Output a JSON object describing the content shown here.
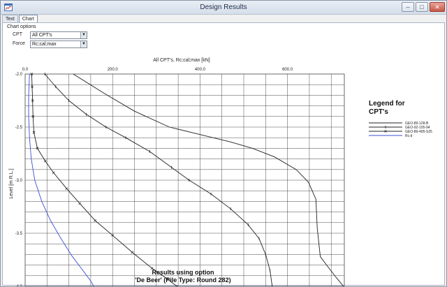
{
  "window": {
    "title": "Design Results",
    "minimize": "–",
    "maximize": "□",
    "close": "✕"
  },
  "tabs": [
    {
      "label": "Text"
    },
    {
      "label": "Chart"
    }
  ],
  "chart_options": {
    "title": "Chart options",
    "cpt_label": "CPT",
    "cpt_value": "All CPT's",
    "force_label": "Force",
    "force_value": "Rc;cal;max"
  },
  "chart_data": {
    "type": "line",
    "title": "All CPT's, Rc;cal;max [kN]",
    "ylabel": "Level [m R.L.]",
    "xlabel": "",
    "xlim": [
      0,
      730
    ],
    "ylim": [
      -4.0,
      -2.0
    ],
    "x_ticks": [
      "0.0",
      "200.0",
      "400.0",
      "600.0"
    ],
    "x_tick_values": [
      0,
      200,
      400,
      600
    ],
    "y_ticks": [
      "-2.0",
      "-2.5",
      "-3.0",
      "-3.5",
      "-4.0"
    ],
    "y_tick_values": [
      -2.0,
      -2.5,
      -3.0,
      -3.5,
      -4.0
    ],
    "grid": true,
    "legend_title": "Legend for CPT's",
    "legend_position": "right",
    "series": [
      {
        "name": "GEO-89-128-B",
        "color": "#222222",
        "marker": "none",
        "x": [
          110,
          180,
          250,
          330,
          410,
          470,
          520,
          570,
          620,
          648,
          665,
          668,
          675,
          695,
          712,
          728
        ],
        "y": [
          -2.0,
          -2.18,
          -2.35,
          -2.5,
          -2.58,
          -2.64,
          -2.7,
          -2.78,
          -2.9,
          -3.02,
          -3.18,
          -3.45,
          -3.72,
          -3.83,
          -3.92,
          -4.0
        ]
      },
      {
        "name": "GEO-92-105-94",
        "color": "#222222",
        "marker": "tick",
        "x": [
          45,
          70,
          100,
          140,
          185,
          230,
          285,
          335,
          375,
          425,
          470,
          510,
          535,
          550,
          560,
          565
        ],
        "y": [
          -2.0,
          -2.12,
          -2.25,
          -2.38,
          -2.5,
          -2.6,
          -2.73,
          -2.88,
          -3.0,
          -3.13,
          -3.27,
          -3.42,
          -3.55,
          -3.7,
          -3.85,
          -4.0
        ]
      },
      {
        "name": "GEO-89-495-S25",
        "color": "#222222",
        "marker": "x",
        "x": [
          15,
          16,
          17,
          18,
          20,
          28,
          46,
          65,
          95,
          125,
          160,
          200,
          245,
          290,
          325,
          347
        ],
        "y": [
          -2.0,
          -2.12,
          -2.25,
          -2.4,
          -2.55,
          -2.7,
          -2.82,
          -2.93,
          -3.08,
          -3.22,
          -3.38,
          -3.52,
          -3.68,
          -3.83,
          -3.93,
          -4.0
        ]
      },
      {
        "name": "Rc;d",
        "color": "#3b4fd6",
        "marker": "none",
        "x": [
          10,
          8,
          8,
          10,
          14,
          22,
          38,
          58,
          82,
          108,
          132,
          150,
          157
        ],
        "y": [
          -2.0,
          -2.2,
          -2.4,
          -2.6,
          -2.8,
          -3.0,
          -3.2,
          -3.38,
          -3.55,
          -3.72,
          -3.85,
          -3.95,
          -4.0
        ]
      }
    ],
    "footer_line1": "Results using option",
    "footer_line2": "'De Beer' (Pile Type: Round 282)"
  }
}
